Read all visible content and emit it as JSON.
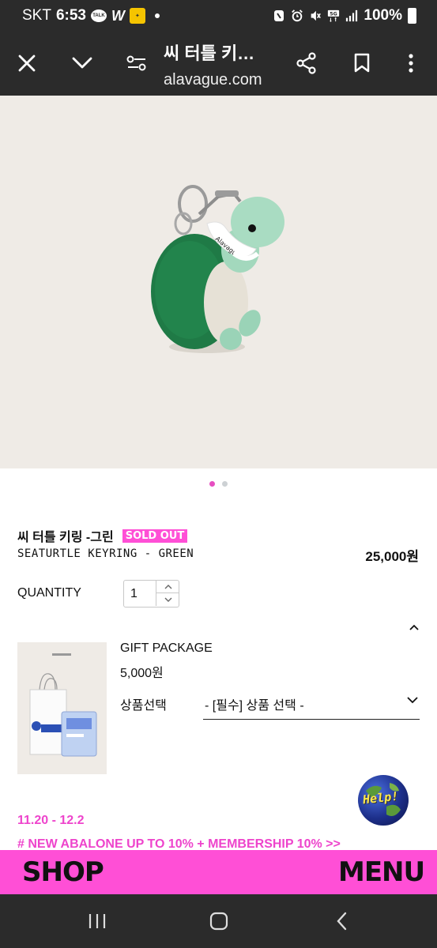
{
  "status_bar": {
    "carrier": "SKT",
    "time": "6:53",
    "talk_label": "TALK",
    "w_label": "W",
    "battery": "100%"
  },
  "browser": {
    "title": "씨 터틀 키…",
    "url": "alavague.com",
    "icons": [
      "close-icon",
      "chevron-down-icon",
      "tune-icon",
      "share-icon",
      "bookmark-icon",
      "more-vert-icon"
    ]
  },
  "carousel": {
    "count": 2,
    "active_index": 0
  },
  "product": {
    "name": "씨 터틀 키링 -그린",
    "badge": "SOLD OUT",
    "english_name": "SEATURTLE KEYRING - GREEN",
    "price": "25,000원",
    "quantity_label": "QUANTITY",
    "quantity_value": "1"
  },
  "gift": {
    "title": "GIFT PACKAGE",
    "price": "5,000원",
    "option_label": "상품선택",
    "select_value": "- [필수] 상품 선택 -"
  },
  "help_button": {
    "label": "Help!"
  },
  "promo": {
    "dates": "11.20 - 12.2",
    "text": "# NEW ABALONE UP TO 10% + MEMBERSHIP 10% >>"
  },
  "bottom_bar": {
    "shop_label": "SHOP",
    "menu_label": "MENU"
  },
  "colors": {
    "accent_pink": "#ff4fd6",
    "promo_pink": "#ee44cc",
    "dark_bar": "#2b2b2b",
    "image_bg": "#efebe6"
  }
}
